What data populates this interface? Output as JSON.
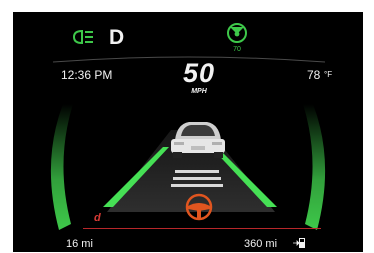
{
  "status": {
    "gear": "D",
    "headlight_icon": "headlight-icon",
    "cruise_icon": "adaptive-cruise-icon",
    "cruise_set_speed": "70"
  },
  "info": {
    "time": "12:36 PM",
    "temperature": "78",
    "temperature_unit": "°F"
  },
  "speed": {
    "value": "50",
    "unit": "MPH"
  },
  "drive_mode": "d",
  "odometer": {
    "trip": "16 mi",
    "range": "360 mi"
  },
  "colors": {
    "background": "#000000",
    "accent_green": "#3ec84a",
    "steering_orange": "#e0551f",
    "mode_red": "#d63a34"
  }
}
